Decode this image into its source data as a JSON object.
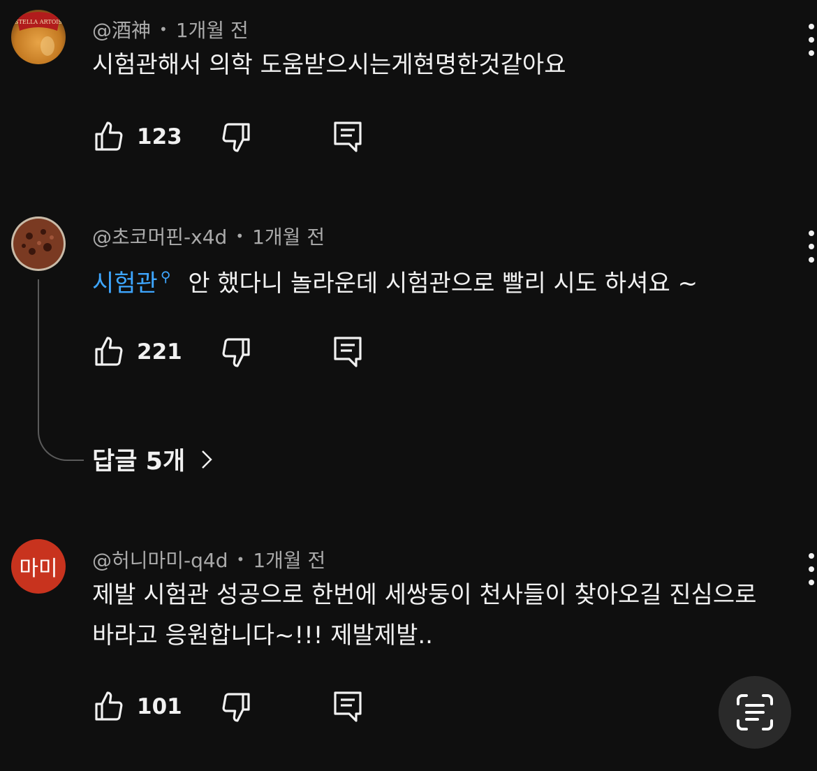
{
  "comments": [
    {
      "handle": "@酒神",
      "time": "1개월 전",
      "text": "시험관해서 의학 도움받으시는게현명한것같아요",
      "likes": "123",
      "avatar_text": "STELLA ARTOIS"
    },
    {
      "handle": "@초코머핀-x4d",
      "time": "1개월 전",
      "link_text": "시험관",
      "text": "안 했다니 놀라운데 시험관으로 빨리 시도 하셔요 ~",
      "likes": "221",
      "replies_label": "답글 5개"
    },
    {
      "handle": "@허니마미-q4d",
      "time": "1개월 전",
      "text_line1": "제발 시험관 성공으로 한번에 세쌍둥이 천사들이 찾아오길 진심으로",
      "text_line2": "바라고 응원합니다~!!! 제발제발..",
      "likes": "101",
      "avatar_text": "마미"
    }
  ],
  "colors": {
    "background": "#0f0f0f",
    "link": "#3ea6ff",
    "avatar3": "#c8331e"
  }
}
